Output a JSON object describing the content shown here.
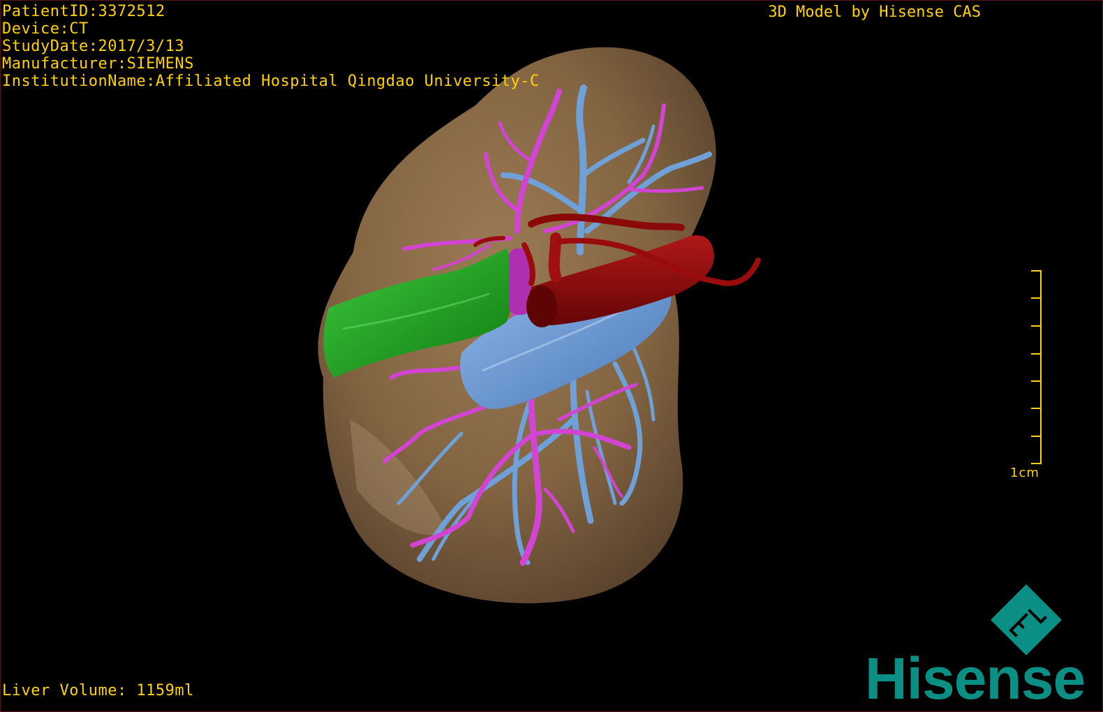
{
  "overlay": {
    "patient_id": "PatientID:3372512",
    "device": "Device:CT",
    "study_date": "StudyDate:2017/3/13",
    "manufacturer": "Manufacturer:SIEMENS",
    "institution": "InstitutionName:Affiliated Hospital Qingdao University-C",
    "credit": "3D Model by Hisense CAS",
    "liver_volume": "Liver Volume: 1159ml"
  },
  "scale": {
    "label": "1cm"
  },
  "brand": {
    "logo_letters": "F L",
    "name": "Hisense"
  },
  "colors": {
    "overlay_text": "#ffd200",
    "liver": "#8a6a45",
    "hepatic_vein": "#6fa0d8",
    "portal_vein": "#d244d2",
    "tumor": "#1aa81a",
    "vena_cava": "#8a0a0a",
    "brand": "#0b8f85"
  }
}
